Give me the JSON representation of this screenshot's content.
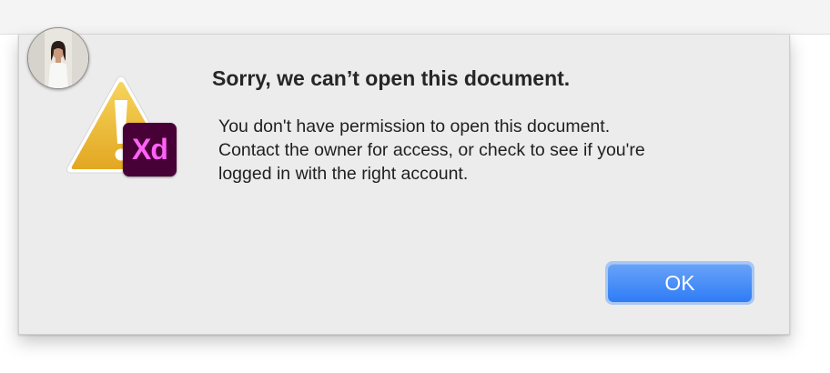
{
  "dialog": {
    "title": "Sorry, we can’t open this document.",
    "message_lines": [
      "You don't have permission to open this document.",
      "Contact the owner for access, or check to see if you're",
      "logged in with the right account."
    ],
    "ok_label": "OK",
    "app_badge": "Xd",
    "icons": {
      "alert": "warning-triangle-icon",
      "app": "adobe-xd-icon",
      "avatar": "user-avatar"
    },
    "colors": {
      "button": "#2f7cf6",
      "xd_background": "#470137",
      "xd_text": "#ff61f6",
      "warning": "#e9b630"
    }
  }
}
